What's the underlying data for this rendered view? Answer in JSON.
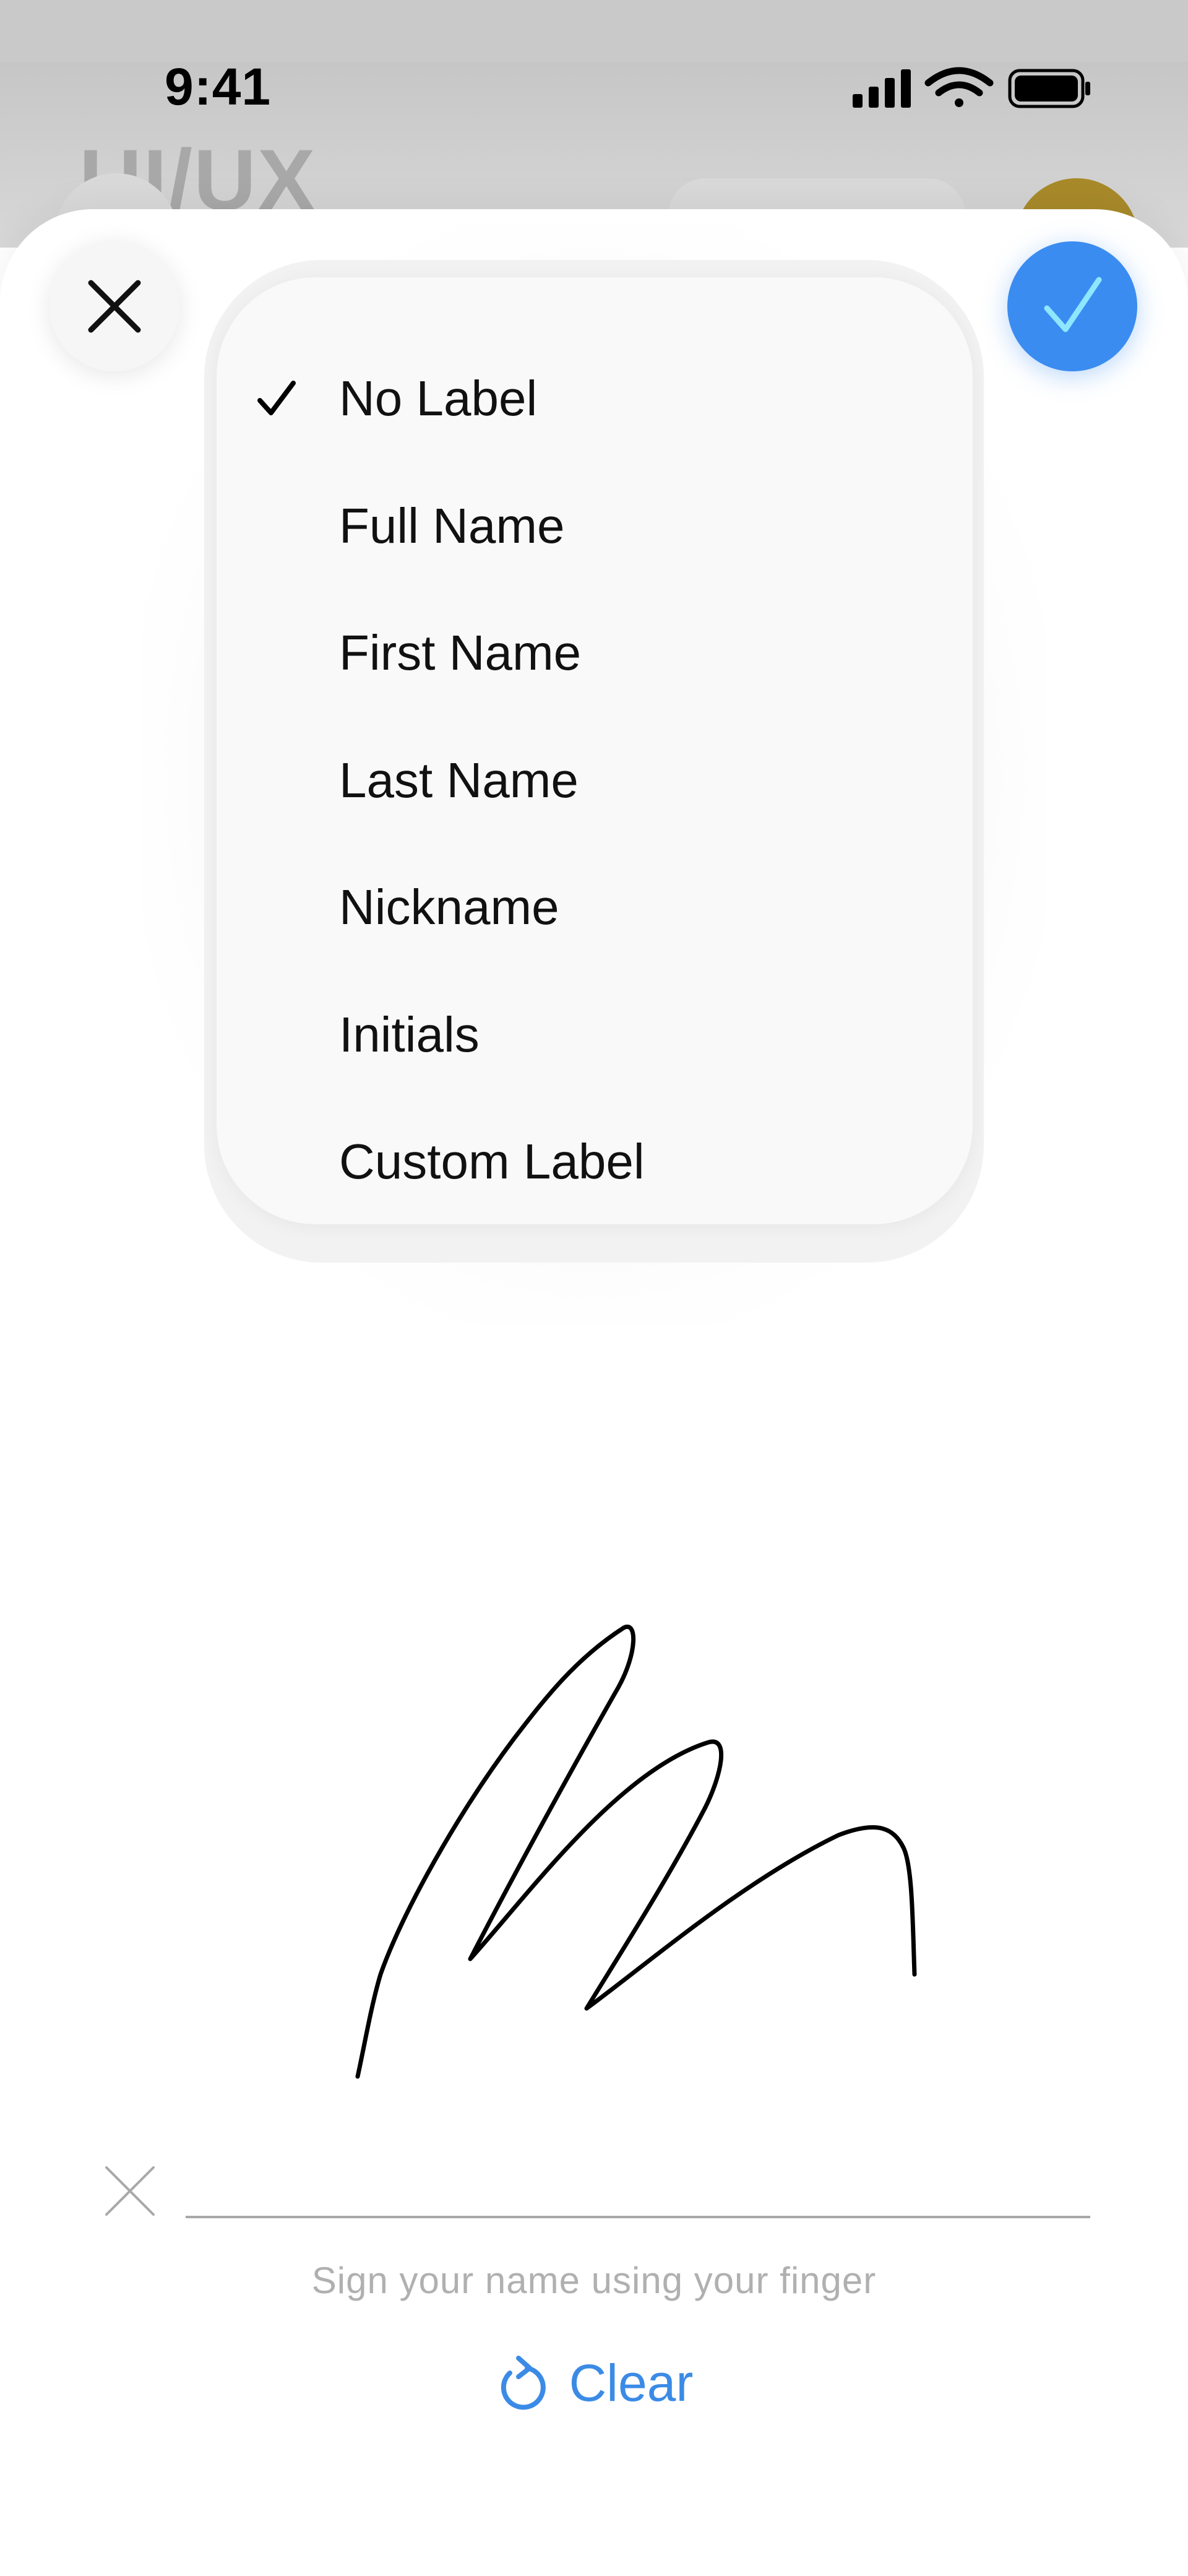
{
  "status_bar": {
    "time": "9:41"
  },
  "background": {
    "title": "UI/UX"
  },
  "menu": {
    "items": [
      {
        "label": "No Label",
        "selected": true
      },
      {
        "label": "Full Name",
        "selected": false
      },
      {
        "label": "First Name",
        "selected": false
      },
      {
        "label": "Last Name",
        "selected": false
      },
      {
        "label": "Nickname",
        "selected": false
      },
      {
        "label": "Initials",
        "selected": false
      },
      {
        "label": "Custom Label",
        "selected": false
      }
    ]
  },
  "signature": {
    "hint": "Sign your name using your finger",
    "clear_label": "Clear"
  },
  "icons": {
    "close": "close-icon",
    "confirm": "checkmark-icon",
    "selected": "checkmark-icon",
    "clear": "undo-icon",
    "baseline": "close-icon",
    "status": [
      "cellular-signal-icon",
      "wifi-icon",
      "battery-icon"
    ]
  },
  "colors": {
    "accent": "#3a8cf0",
    "link": "#3b8be6",
    "sheet": "#ffffff",
    "menu_background": "#f9f9f9",
    "hint_text": "#b0b0b0",
    "avatar": "#a88a2a"
  }
}
